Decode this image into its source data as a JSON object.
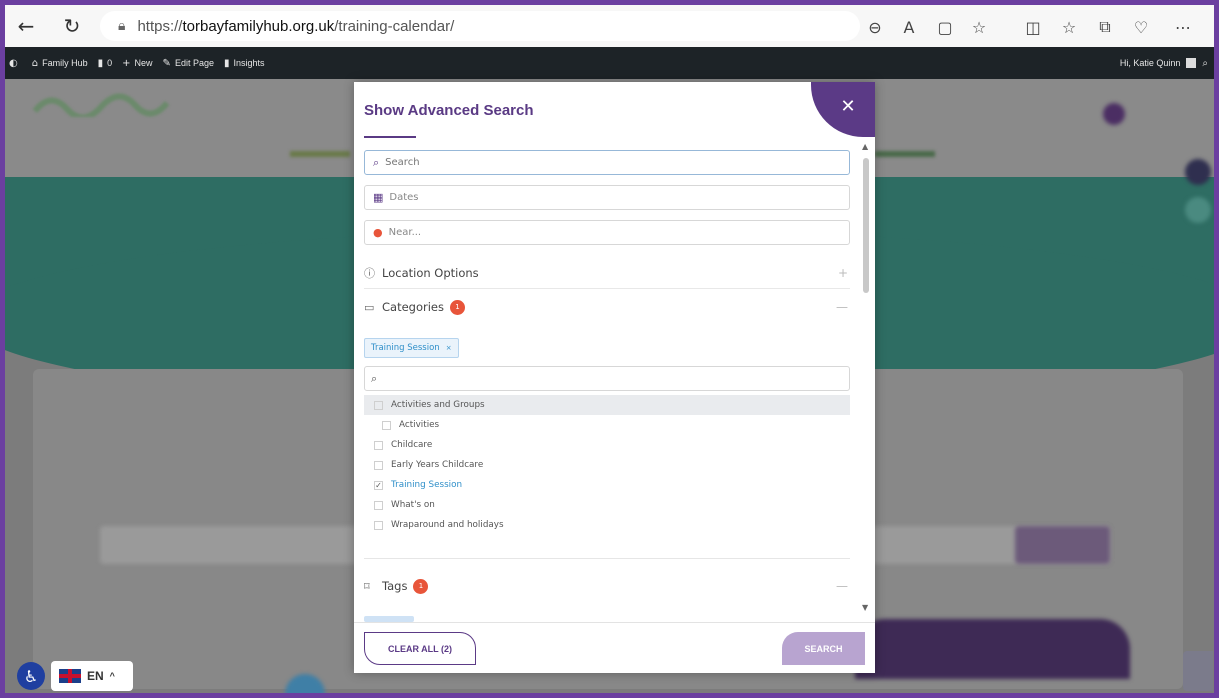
{
  "browser": {
    "url_prefix": "https://",
    "url_domain": "torbayfamilyhub.org.uk",
    "url_path": "/training-calendar/"
  },
  "admin_bar": {
    "site": "Family Hub",
    "comments": "0",
    "new": "New",
    "edit": "Edit Page",
    "insights": "Insights",
    "greeting": "Hi, Katie Quinn"
  },
  "modal": {
    "title": "Show Advanced Search",
    "search_placeholder": "Search",
    "dates_placeholder": "Dates",
    "near_placeholder": "Near...",
    "location_options": "Location Options",
    "categories_label": "Categories",
    "categories_count": "1",
    "selected_tag": "Training Session",
    "options": [
      {
        "label": "Activities and Groups",
        "checked": false
      },
      {
        "label": "Activities",
        "checked": false
      },
      {
        "label": "Childcare",
        "checked": false
      },
      {
        "label": "Early Years Childcare",
        "checked": false
      },
      {
        "label": "Training Session",
        "checked": true
      },
      {
        "label": "What's on",
        "checked": false
      },
      {
        "label": "Wraparound and holidays",
        "checked": false
      }
    ],
    "tags_label": "Tags",
    "tags_count": "1",
    "clear_all": "CLEAR ALL (2)",
    "search_button": "SEARCH"
  },
  "language": {
    "code": "EN"
  }
}
